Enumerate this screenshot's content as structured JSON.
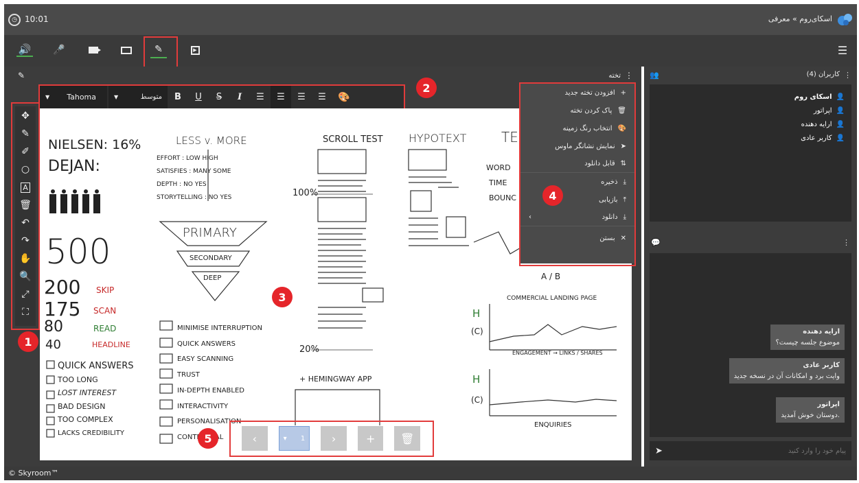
{
  "header": {
    "time": "10:01",
    "breadcrumb": "اسکای‌روم » معرفی"
  },
  "board_panel": {
    "title": "تخته"
  },
  "format_toolbar": {
    "font": "Tahoma",
    "size": "متوسط",
    "bold": "B",
    "underline": "U",
    "strike": "S",
    "italic": "I"
  },
  "board_menu": {
    "items": [
      {
        "label": "افزودن تخته جدید",
        "icon": "plus-icon"
      },
      {
        "label": "پاک کردن تخته",
        "icon": "trash-icon"
      },
      {
        "label": "انتخاب رنگ زمینه",
        "icon": "palette-icon"
      },
      {
        "label": "نمایش نشانگر ماوس",
        "icon": "cursor-icon"
      },
      {
        "label": "قابل دانلود",
        "icon": "sort-icon"
      },
      {
        "label": "ذخیره",
        "icon": "download-icon"
      },
      {
        "label": "بازیابی",
        "icon": "upload-icon"
      },
      {
        "label": "دانلود",
        "icon": "download-icon"
      },
      {
        "label": "بستن",
        "icon": "close-icon"
      }
    ]
  },
  "users": {
    "title": "کاربران (4)",
    "list": [
      {
        "name": "اسکای روم",
        "color": "#e53935"
      },
      {
        "name": "اپراتور",
        "color": "#42a5f5"
      },
      {
        "name": "ارایه دهنده",
        "color": "#66bb6a"
      },
      {
        "name": "کاربر عادی",
        "color": "#ffffff"
      }
    ]
  },
  "chat": {
    "placeholder": "پیام خود را وارد کنید",
    "messages": [
      {
        "sender": "ارایه دهنده",
        "text": "موضوع جلسه چیست؟"
      },
      {
        "sender": "کاربر عادی",
        "text": "وایت برد و امکانات آن در نسخه جدید"
      },
      {
        "sender": "اپراتور",
        "text": "دوستان خوش آمدید."
      }
    ]
  },
  "pager": {
    "page": "1"
  },
  "badges": [
    "1",
    "2",
    "3",
    "4",
    "5"
  ],
  "footer": "© Skyroom™",
  "board_sketch": {
    "nielsen": "NIELSEN: 16%",
    "dejan": "DEJAN:",
    "n500": "500",
    "n200": "200",
    "skip": "SKIP",
    "n175": "175",
    "scan": "SCAN",
    "n80": "80",
    "read": "READ",
    "n40": "40",
    "headline": "HEADLINE",
    "left_checks": [
      "QUICK ANSWERS",
      "TOO LONG",
      "LOST INTEREST",
      "BAD DESIGN",
      "TOO COMPLEX",
      "LACKS CREDIBILITY"
    ],
    "less_more": "LESS v. MORE",
    "lm_rows": [
      "EFFORT : LOW   HIGH",
      "SATISFIES : MANY  SOME",
      "DEPTH : NO   YES",
      "STORYTELLING : NO  YES"
    ],
    "primary": "PRIMARY",
    "secondary": "SECONDARY",
    "deep": "DEEP",
    "mid_checks": [
      "MINIMISE INTERRUPTION",
      "QUICK ANSWERS",
      "EASY SCANNING",
      "TRUST",
      "IN-DEPTH ENABLED",
      "INTERACTIVITY",
      "PERSONALISATION",
      "CONTEXTUAL"
    ],
    "scroll_test": "SCROLL TEST",
    "p100": "100%",
    "p20": "20%",
    "hemingway": "+ HEMINGWAY APP",
    "hypotext": "HYPOTEXT",
    "te": "TE",
    "word": "WORD",
    "time": "TIME",
    "bounc": "BOUNC",
    "ab": "A / B",
    "commercial": "COMMERCIAL LANDING PAGE",
    "engagement": "ENGAGEMENT → LINKS / SHARES",
    "enquiries": "ENQUIRIES",
    "h": "H",
    "c": "(C)"
  }
}
